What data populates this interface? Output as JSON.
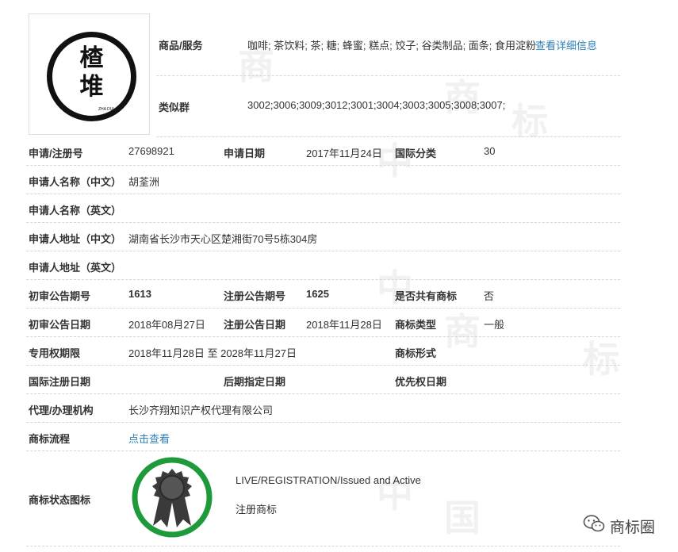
{
  "logo": {
    "char_top": "楂",
    "char_bottom": "堆",
    "subtitle": "ZHA DUI"
  },
  "goods": {
    "label": "商品/服务",
    "value": "咖啡; 茶饮料; 茶; 糖; 蜂蜜; 糕点; 饺子; 谷类制品; 面条; 食用淀粉",
    "link": "查看详细信息"
  },
  "similar_group": {
    "label": "类似群",
    "value": "3002;3006;3009;3012;3001;3004;3003;3005;3008;3007;"
  },
  "rows": {
    "reg_no": {
      "label": "申请/注册号",
      "value": "27698921"
    },
    "apply_date": {
      "label": "申请日期",
      "value": "2017年11月24日"
    },
    "intl_class": {
      "label": "国际分类",
      "value": "30"
    },
    "applicant_cn": {
      "label": "申请人名称（中文）",
      "value": "胡荃洲"
    },
    "applicant_en": {
      "label": "申请人名称（英文）",
      "value": ""
    },
    "address_cn": {
      "label": "申请人地址（中文）",
      "value": "湖南省长沙市天心区楚湘街70号5栋304房"
    },
    "address_en": {
      "label": "申请人地址（英文）",
      "value": ""
    },
    "prelim_issue": {
      "label": "初审公告期号",
      "value": "1613"
    },
    "reg_issue": {
      "label": "注册公告期号",
      "value": "1625"
    },
    "shared": {
      "label": "是否共有商标",
      "value": "否"
    },
    "prelim_date": {
      "label": "初审公告日期",
      "value": "2018年08月27日"
    },
    "reg_date": {
      "label": "注册公告日期",
      "value": "2018年11月28日"
    },
    "mark_type": {
      "label": "商标类型",
      "value": "一般"
    },
    "exclusive_period": {
      "label": "专用权期限",
      "value": "2018年11月28日 至 2028年11月27日"
    },
    "mark_form": {
      "label": "商标形式",
      "value": ""
    },
    "intl_reg_date": {
      "label": "国际注册日期",
      "value": ""
    },
    "later_date": {
      "label": "后期指定日期",
      "value": ""
    },
    "priority_date": {
      "label": "优先权日期",
      "value": ""
    },
    "agency": {
      "label": "代理/办理机构",
      "value": "长沙齐翔知识产权代理有限公司"
    },
    "flow": {
      "label": "商标流程",
      "value": "点击查看"
    },
    "status": {
      "label": "商标状态图标",
      "en": "LIVE/REGISTRATION/Issued and Active",
      "cn": "注册商标"
    }
  },
  "watermark": {
    "chars": [
      "中",
      "国",
      "商",
      "标"
    ]
  },
  "wechat": {
    "icon": "wechat-icon",
    "name": "商标圈"
  },
  "colors": {
    "link": "#2b7fb8",
    "badge_ring": "#1f9a3a",
    "medal": "#3a3a3a"
  }
}
